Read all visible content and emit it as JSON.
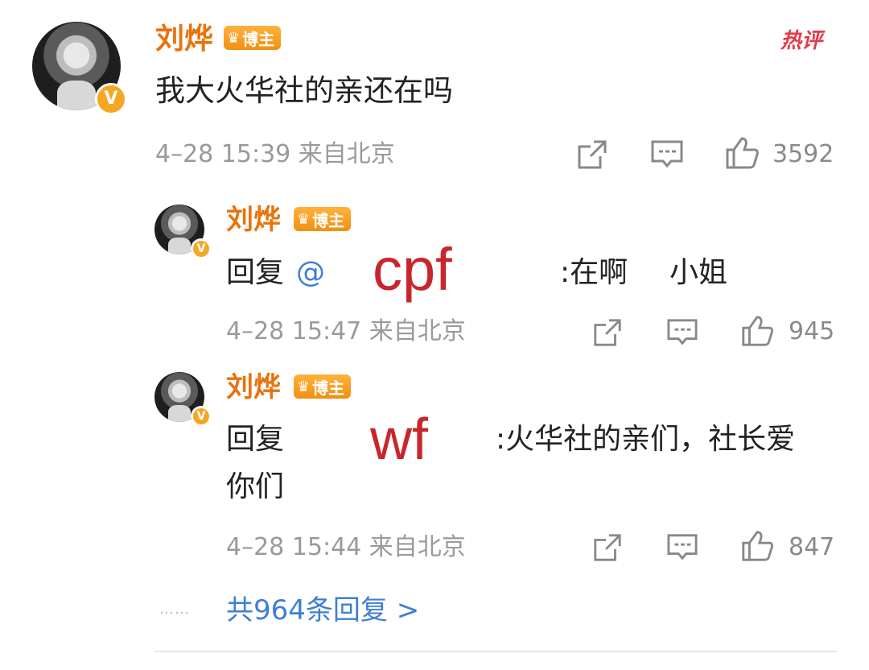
{
  "comment": {
    "author": "刘烨",
    "badge": "博主",
    "text": "我大火华社的亲还在吗",
    "meta": "4–28 15:39 来自北京",
    "likes": "3592",
    "tag": "热评"
  },
  "replies": [
    {
      "author": "刘烨",
      "badge": "博主",
      "prefix": "回复",
      "mention": "@",
      "redacted": "cpf",
      "body": ":在啊",
      "body2": "小姐",
      "meta": "4–28 15:47 来自北京",
      "likes": "945"
    },
    {
      "author": "刘烨",
      "badge": "博主",
      "prefix": "回复",
      "redacted": "wf",
      "body": ":火华社的亲们，社长爱",
      "body_line2": "你们",
      "meta": "4–28 15:44 来自北京",
      "likes": "847"
    }
  ],
  "footer": {
    "dots": "……",
    "more_replies": "共964条回复 >"
  },
  "colors": {
    "name": "#e8730c",
    "badge": "#f5a623",
    "link": "#3e7fd4",
    "redaction": "#c8262c"
  }
}
